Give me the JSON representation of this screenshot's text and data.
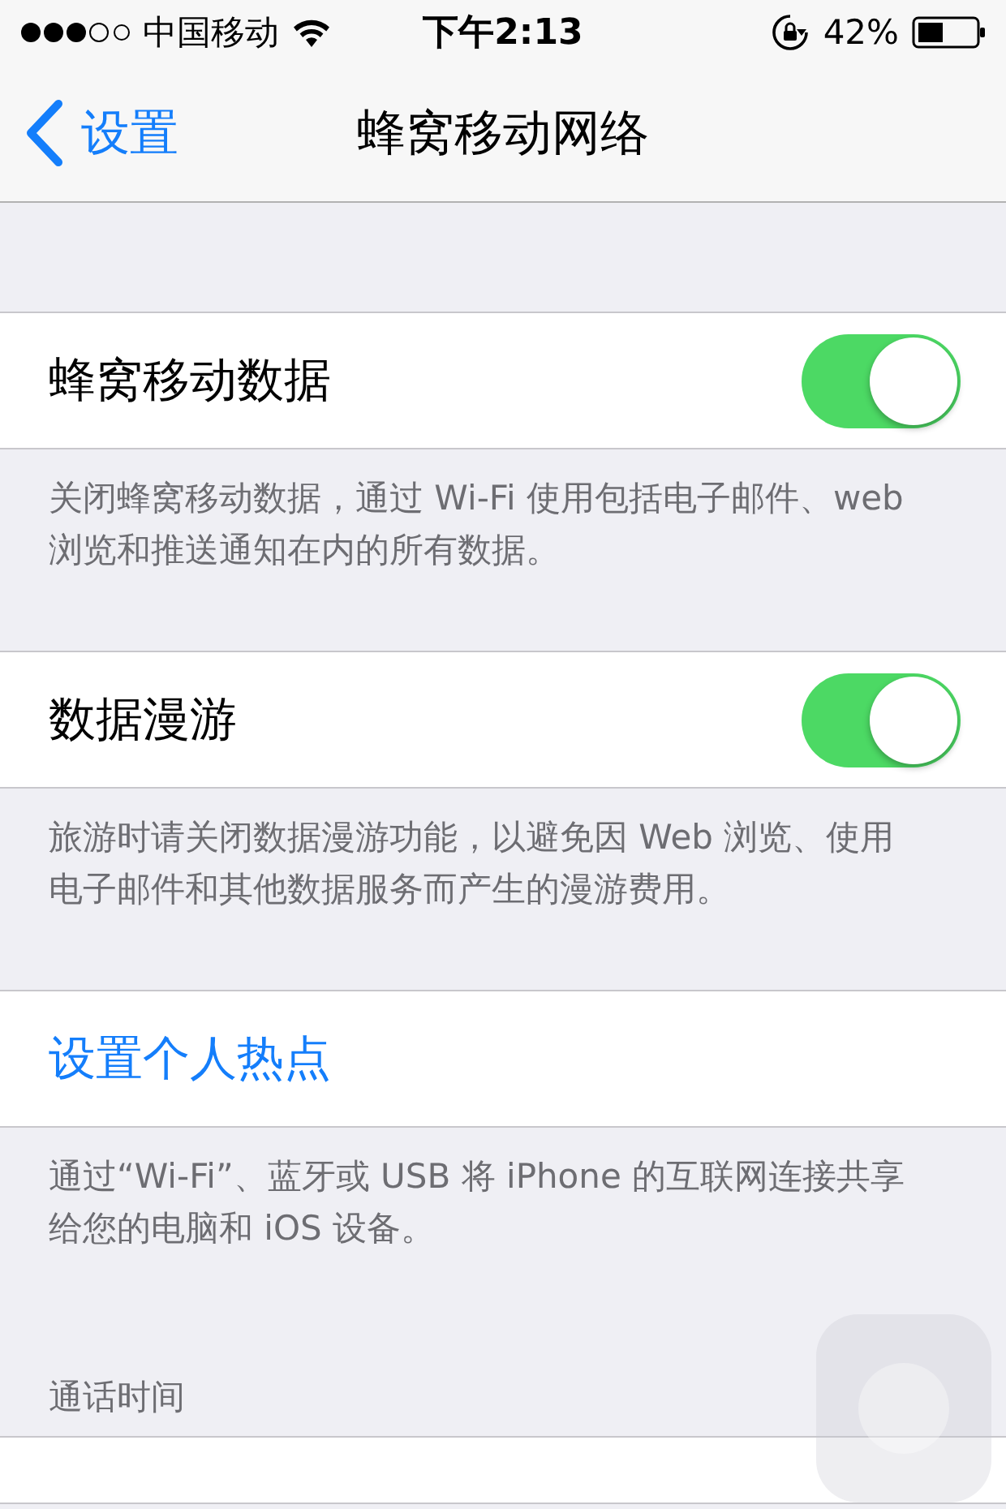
{
  "status_bar": {
    "carrier": "中国移动",
    "time": "下午2:13",
    "battery": "42%"
  },
  "nav": {
    "back": "设置",
    "title": "蜂窝移动网络"
  },
  "sections": [
    {
      "kind": "toggle",
      "label": "蜂窝移动数据",
      "on": true,
      "footer": "关闭蜂窝移动数据，通过 Wi-Fi 使用包括电子邮件、web 浏览和推送通知在内的所有数据。"
    },
    {
      "kind": "toggle",
      "label": "数据漫游",
      "on": true,
      "footer": "旅游时请关闭数据漫游功能，以避免因 Web 浏览、使用电子邮件和其他数据服务而产生的漫游费用。"
    },
    {
      "kind": "link",
      "label": "设置个人热点",
      "footer": "通过“Wi-Fi”、蓝牙或 USB 将 iPhone 的互联网连接共享给您的电脑和 iOS 设备。"
    },
    {
      "kind": "header",
      "label": "通话时间"
    }
  ]
}
